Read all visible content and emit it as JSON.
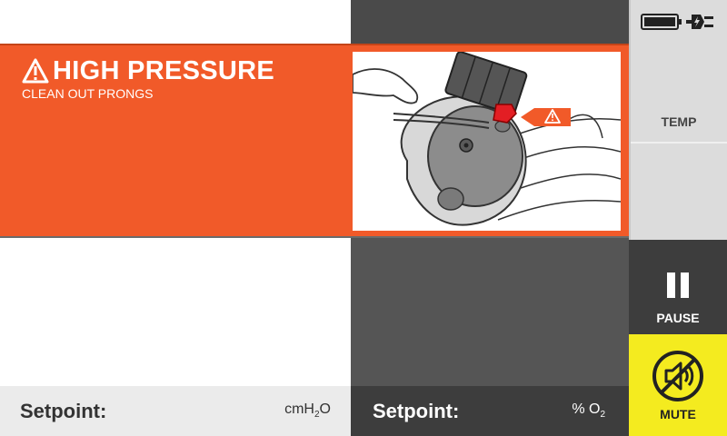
{
  "alarm": {
    "title": "HIGH PRESSURE",
    "subtitle": "CLEAN OUT PRONGS",
    "color": "#f15a29",
    "icon": "warning-triangle-icon",
    "illustration": "infant-nasal-prongs-illustration"
  },
  "sidebar": {
    "battery_icon": "battery-full-icon",
    "power_icon": "ac-power-plug-icon",
    "temp_label": "TEMP",
    "pause_label": "PAUSE",
    "pause_icon": "pause-icon",
    "mute_label": "MUTE",
    "mute_icon": "speaker-muted-icon",
    "mute_color": "#f4eb1f"
  },
  "setpoints": {
    "pressure_label": "Setpoint:",
    "pressure_unit": "cmH",
    "pressure_unit_sub": "2",
    "pressure_unit_tail": "O",
    "oxygen_label": "Setpoint:",
    "oxygen_unit": "% O",
    "oxygen_unit_sub": "2"
  }
}
